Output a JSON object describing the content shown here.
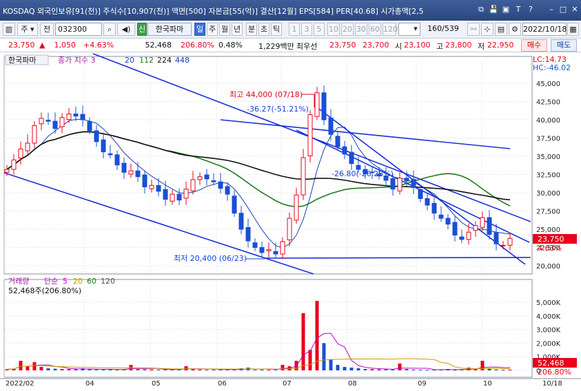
{
  "titlebar": {
    "title": "KOSDAQ 외국인보유[91(천)] 주식수[10,907(천)] 액면[500] 자본금[55(억)] 결산[12월] EPS[584] PER[40.68] 시가총액[2,5",
    "buttons": [
      "⧉",
      "💾",
      "▣",
      "T",
      "?",
      "–",
      "□",
      "✕"
    ]
  },
  "toolbar": {
    "menu_label": "주",
    "market_label": "전",
    "code": "032300",
    "stock_tag": "신",
    "stock_name": "한국파마",
    "periods": [
      "일",
      "주",
      "월",
      "년",
      "분",
      "초",
      "틱"
    ],
    "selected_period": "일",
    "minute_options": [
      "1",
      "3",
      "5",
      "10",
      "20",
      "30",
      "60",
      "120"
    ],
    "count": "160/539",
    "date": "2022/10/18"
  },
  "quote": {
    "price": "23,750",
    "change": "1,050",
    "change_pct": "+4.63%",
    "volume": "52,468",
    "volume_ratio": "206.80%",
    "turnover": "0.48%",
    "amount": "1,229백만",
    "preferred": "최우선",
    "ask": "23,750",
    "bid": "23,700",
    "open_label": "시",
    "open": "23,100",
    "high_label": "고",
    "high": "23,800",
    "low_label": "저",
    "low": "22,950",
    "buy_label": "매수",
    "sell_label": "매도"
  },
  "chart_data": {
    "type": "line",
    "price_panel": {
      "legend_name": "한국파마",
      "legend_ma": "종가 지수 3",
      "ma_periods": [
        "20",
        "112",
        "224",
        "448"
      ],
      "lc_label": "LC:14.73",
      "hc_label": "HC:-46.02",
      "y_ticks": [
        "45,000",
        "42,500",
        "40,000",
        "37,500",
        "35,000",
        "32,500",
        "30,000",
        "27,500",
        "25,000",
        "22,500",
        "20,000"
      ],
      "ylim": [
        20000,
        45000
      ],
      "current_price": "23,750",
      "current_pct": "4.63%",
      "high_annotation": "최고 44,000 (07/18)",
      "low_annotation": "최저 20,400 (06/23)",
      "drop_annotation_1": "-36.27(-51.21%)",
      "drop_annotation_2": "-26.80(-26.28%)",
      "candles_close": [
        33200,
        34500,
        36000,
        36800,
        39200,
        40200,
        39800,
        38800,
        40300,
        40800,
        40500,
        40000,
        38500,
        37000,
        35600,
        35200,
        33800,
        32800,
        33000,
        32200,
        30800,
        31000,
        30200,
        29100,
        29800,
        29000,
        30500,
        31800,
        32200,
        31900,
        31500,
        30600,
        29800,
        27200,
        25000,
        23400,
        22500,
        21800,
        22200,
        21600,
        23300,
        26500,
        29700,
        34800,
        40700,
        43700,
        40000,
        38000,
        36300,
        35300,
        34000,
        33200,
        32600,
        32800,
        32300,
        31700,
        30500,
        32000,
        31600,
        30700,
        29200,
        28300,
        27200,
        26500,
        25700,
        24200,
        23600,
        24600,
        25500,
        26600,
        24300,
        23000,
        22800,
        23750
      ]
    },
    "volume_panel": {
      "legend": "거래량",
      "ma_label": "단순",
      "ma_periods": [
        "5",
        "20",
        "60",
        "120"
      ],
      "value_label": "52,468주(206.80%)",
      "y_ticks": [
        "5,000K",
        "4,000K",
        "3,000K",
        "2,000K",
        "1,000K",
        "0"
      ],
      "ylim": [
        0,
        5000000
      ],
      "current_volume": "52,468",
      "current_ratio": "206.80%",
      "volumes": [
        80000,
        120000,
        700000,
        300000,
        600000,
        250000,
        150000,
        120000,
        100000,
        90000,
        80000,
        150000,
        70000,
        60000,
        60000,
        70000,
        60000,
        80000,
        400000,
        90000,
        80000,
        70000,
        60000,
        50000,
        70000,
        60000,
        300000,
        80000,
        60000,
        50000,
        60000,
        70000,
        60000,
        50000,
        150000,
        200000,
        50000,
        60000,
        40000,
        50000,
        400000,
        300000,
        700000,
        4200000,
        1500000,
        5100000,
        2000000,
        800000,
        400000,
        250000,
        200000,
        150000,
        100000,
        90000,
        80000,
        70000,
        60000,
        500000,
        100000,
        60000,
        50000,
        40000,
        40000,
        50000,
        100000,
        40000,
        50000,
        200000,
        80000,
        700000,
        150000,
        60000,
        40000,
        52468
      ]
    },
    "x_axis": [
      "2022/02",
      "04",
      "05",
      "06",
      "07",
      "08",
      "09",
      "10",
      "10/18"
    ]
  },
  "colors": {
    "up": "#e8001c",
    "down": "#1a4fd6",
    "ma20": "#1a3fb0",
    "ma112": "#1f7a1f",
    "ma224": "#111111",
    "trend": "#1a2fd6",
    "grid": "#d8d8e0"
  }
}
